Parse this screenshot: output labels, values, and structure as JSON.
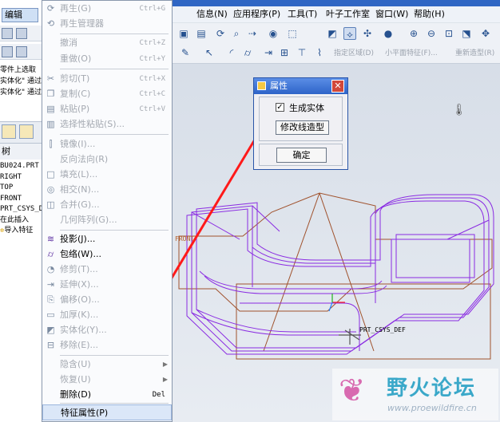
{
  "left": {
    "tab_label": "编辑",
    "messages": [
      "零件上选取",
      "实体化\" 通过",
      "实体化\" 通过"
    ],
    "tree_header": "树",
    "tree_items": [
      "BU024.PRT",
      "RIGHT",
      "TOP",
      "FRONT",
      "PRT_CSYS_DI",
      "在此插入",
      "导入特征"
    ]
  },
  "menu": {
    "items": [
      {
        "label": "再生(G)",
        "shortcut": "Ctrl+G",
        "icon": "regenerate-icon",
        "disabled": true
      },
      {
        "label": "再生管理器",
        "shortcut": "",
        "icon": "regen-manager-icon",
        "disabled": true
      },
      {
        "label": "撤消",
        "shortcut": "Ctrl+Z",
        "icon": "",
        "disabled": true
      },
      {
        "label": "重做(O)",
        "shortcut": "Ctrl+Y",
        "icon": "",
        "disabled": true
      },
      {
        "label": "剪切(T)",
        "shortcut": "Ctrl+X",
        "icon": "scissors-icon",
        "disabled": true
      },
      {
        "label": "复制(C)",
        "shortcut": "Ctrl+C",
        "icon": "copy-icon",
        "disabled": true
      },
      {
        "label": "粘贴(P)",
        "shortcut": "Ctrl+V",
        "icon": "paste-icon",
        "disabled": true
      },
      {
        "label": "选择性粘贴(S)...",
        "shortcut": "",
        "icon": "paste-special-icon",
        "disabled": true
      },
      {
        "label": "镜像(I)...",
        "shortcut": "",
        "icon": "mirror-icon",
        "disabled": true
      },
      {
        "label": "反向法向(R)",
        "shortcut": "",
        "icon": "",
        "disabled": true
      },
      {
        "label": "填充(L)...",
        "shortcut": "",
        "icon": "fill-icon",
        "disabled": true
      },
      {
        "label": "相交(N)...",
        "shortcut": "",
        "icon": "intersect-icon",
        "disabled": true
      },
      {
        "label": "合并(G)...",
        "shortcut": "",
        "icon": "merge-icon",
        "disabled": true
      },
      {
        "label": "几何阵列(G)...",
        "shortcut": "",
        "icon": "",
        "disabled": true
      },
      {
        "label": "投影(J)...",
        "shortcut": "",
        "icon": "project-icon",
        "disabled": false
      },
      {
        "label": "包络(W)...",
        "shortcut": "",
        "icon": "wrap-icon",
        "disabled": false
      },
      {
        "label": "修剪(T)...",
        "shortcut": "",
        "icon": "trim-icon",
        "disabled": true
      },
      {
        "label": "延伸(X)...",
        "shortcut": "",
        "icon": "extend-icon",
        "disabled": true
      },
      {
        "label": "偏移(O)...",
        "shortcut": "",
        "icon": "offset-icon",
        "disabled": true
      },
      {
        "label": "加厚(K)...",
        "shortcut": "",
        "icon": "thicken-icon",
        "disabled": true
      },
      {
        "label": "实体化(Y)...",
        "shortcut": "",
        "icon": "solidify-icon",
        "disabled": true
      },
      {
        "label": "移除(E)...",
        "shortcut": "",
        "icon": "remove-icon",
        "disabled": true
      },
      {
        "label": "隐含(U)",
        "shortcut": "",
        "icon": "",
        "disabled": true,
        "submenu": true
      },
      {
        "label": "恢复(U)",
        "shortcut": "",
        "icon": "",
        "disabled": true,
        "submenu": true
      },
      {
        "label": "删除(D)",
        "shortcut": "Del",
        "icon": "",
        "disabled": false
      },
      {
        "label": "特征属性(P)",
        "shortcut": "",
        "icon": "",
        "disabled": false,
        "highlighted": true
      }
    ]
  },
  "menubar": {
    "items": [
      "信息(N)",
      "应用程序(P)",
      "工具(T)",
      "叶子工作室",
      "窗口(W)",
      "帮助(H)"
    ]
  },
  "toolbar2": {
    "labels": [
      "指定区域(D)",
      "小平面特征(F)...",
      "重新造型(R)"
    ]
  },
  "dialog": {
    "title": "属性",
    "close_glyph": "✕",
    "checkbox_label": "生成实体",
    "checkbox_checked": true,
    "modify_button": "修改线造型",
    "ok_button": "确定"
  },
  "graphics": {
    "csys_label": "PRT_CSYS_DEF",
    "front_label": "FRONT",
    "colors": {
      "wire": "#8a2be2",
      "datum": "#a0522d",
      "arrow": "#ff1a1a"
    }
  },
  "watermark": {
    "title": "野火论坛",
    "url": "www.proewildfire.cn"
  }
}
